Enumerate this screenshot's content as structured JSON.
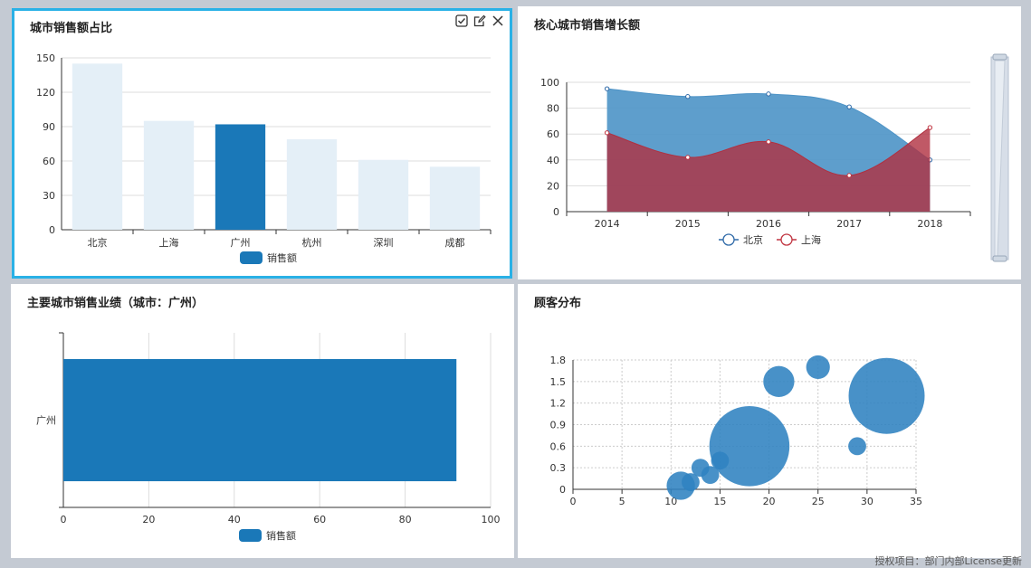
{
  "footer": "授权项目：部门内部License更新",
  "colors": {
    "primary": "#1a78b8",
    "pale": "#e4eff7",
    "beijing": "#4d93c6",
    "shanghai": "#b03040",
    "bubble": "#2f82c0",
    "accent_border": "#2ab1e6"
  },
  "icons": [
    "checkbox-icon",
    "edit-icon",
    "close-icon"
  ],
  "chart_data": [
    {
      "id": "city-share",
      "type": "bar",
      "title": "城市销售额占比",
      "categories": [
        "北京",
        "上海",
        "广州",
        "杭州",
        "深圳",
        "成都"
      ],
      "series": [
        {
          "name": "销售额",
          "values": [
            145,
            95,
            92,
            79,
            61,
            55
          ]
        }
      ],
      "highlight_index": 2,
      "ylim": [
        0,
        150
      ],
      "yticks": [
        0,
        30,
        60,
        90,
        120,
        150
      ],
      "legend": "bottom",
      "grid": true
    },
    {
      "id": "core-growth",
      "type": "area",
      "title": "核心城市销售增长额",
      "x": [
        "2014",
        "2015",
        "2016",
        "2017",
        "2018"
      ],
      "series": [
        {
          "name": "北京",
          "values": [
            95,
            89,
            91,
            81,
            40
          ]
        },
        {
          "name": "上海",
          "values": [
            61,
            42,
            54,
            28,
            65
          ]
        }
      ],
      "ylim": [
        0,
        100
      ],
      "yticks": [
        0,
        20,
        40,
        60,
        80,
        100
      ],
      "legend": "bottom",
      "grid": true,
      "datazoom": "right"
    },
    {
      "id": "main-city",
      "type": "bar",
      "orientation": "horizontal",
      "title": "主要城市销售业绩（城市：广州）",
      "categories": [
        "广州"
      ],
      "series": [
        {
          "name": "销售额",
          "values": [
            92
          ]
        }
      ],
      "xlim": [
        0,
        100
      ],
      "xticks": [
        0,
        20,
        40,
        60,
        80,
        100
      ],
      "legend": "bottom",
      "grid": true
    },
    {
      "id": "customer-dist",
      "type": "scatter",
      "title": "顾客分布",
      "points": [
        {
          "x": 11,
          "y": 0.05,
          "size": 5
        },
        {
          "x": 12,
          "y": 0.1,
          "size": 2
        },
        {
          "x": 13,
          "y": 0.3,
          "size": 2
        },
        {
          "x": 14,
          "y": 0.2,
          "size": 2
        },
        {
          "x": 15,
          "y": 0.4,
          "size": 2
        },
        {
          "x": 18,
          "y": 0.6,
          "size": 40
        },
        {
          "x": 21,
          "y": 1.5,
          "size": 6
        },
        {
          "x": 25,
          "y": 1.7,
          "size": 3.5
        },
        {
          "x": 29,
          "y": 0.6,
          "size": 2
        },
        {
          "x": 32,
          "y": 1.3,
          "size": 36
        }
      ],
      "xlim": [
        0,
        35
      ],
      "xticks": [
        0,
        5,
        10,
        15,
        20,
        25,
        30,
        35
      ],
      "ylim": [
        0,
        1.8
      ],
      "yticks": [
        0,
        0.3,
        0.6,
        0.9,
        1.2,
        1.5,
        1.8
      ],
      "grid": "dashed"
    }
  ]
}
